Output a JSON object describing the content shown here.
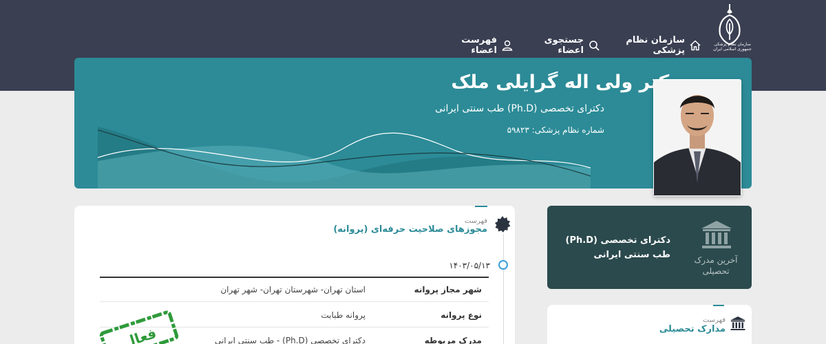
{
  "header": {
    "logo_text": "سازمان نظام پزشکی جمهوری اسلامی ایران",
    "nav": [
      {
        "label": "سازمان نظام پزشکی",
        "icon": "home-icon"
      },
      {
        "label": "جستجوی اعضاء",
        "icon": "search-icon"
      },
      {
        "label": "فهرست اعضاء",
        "icon": "user-icon"
      }
    ]
  },
  "profile": {
    "name": "دکتر ولی اله گرایلی ملک",
    "specialty": "دکترای تخصصی (Ph.D) طب سنتی ایرانی",
    "code_line": "شماره نظام پزشکی: ۵۹۸۲۳"
  },
  "licenses": {
    "list_label": "فهرست",
    "title": "مجوزهای صلاحیت حرفه‌ای (پروانه)",
    "date": "۱۴۰۳/۰۵/۱۳",
    "rows": [
      {
        "label": "شهر مجاز پروانه",
        "value": "استان تهران- شهرستان تهران- شهر تهران"
      },
      {
        "label": "نوع پروانه",
        "value": "پروانه طبابت"
      },
      {
        "label": "مدرک مربوطه",
        "value": "دکترای تخصصی (Ph.D) - طب سنتی ایرانی"
      }
    ],
    "stamp_text": "فعال"
  },
  "latest_degree": {
    "text": "دکترای تخصصی (Ph.D) طب سنتی ایرانی",
    "caption": "آخرین مدرک تحصیلی"
  },
  "degrees": {
    "list_label": "فهرست",
    "title": "مدارک تحصیلی"
  },
  "colors": {
    "header_bg": "#3a3f52",
    "banner_bg": "#2c8b97",
    "edu_card_bg": "#2b4a4d",
    "accent": "#2c8b97",
    "stamp": "#2e9a3a"
  }
}
